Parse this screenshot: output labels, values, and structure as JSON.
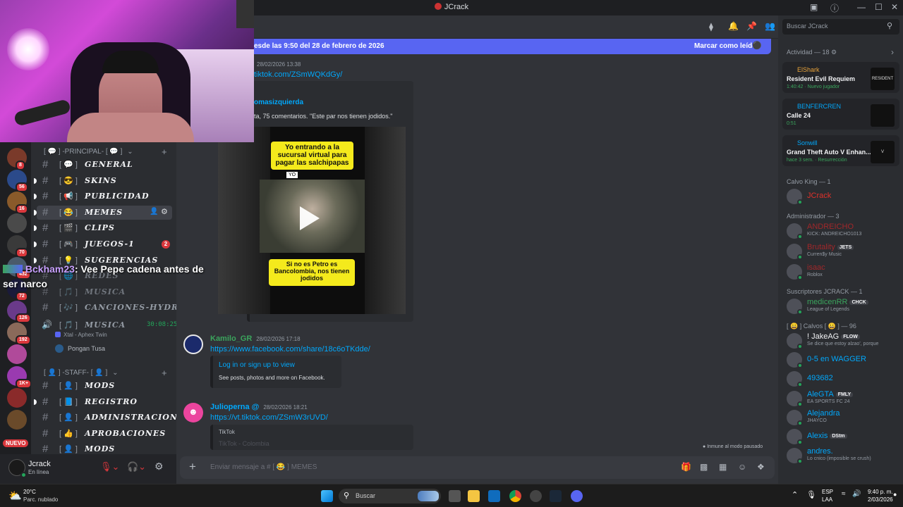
{
  "window": {
    "title": "JCrack",
    "controls": [
      "—",
      "☐",
      "✕"
    ]
  },
  "servers": [
    {
      "badge": "8",
      "color": "#7a3a2a"
    },
    {
      "badge": "56",
      "color": "#2b4a8a"
    },
    {
      "badge": "16",
      "color": "#8a5a2a"
    },
    {
      "badge": "",
      "color": "#4a4a4a"
    },
    {
      "badge": "70",
      "color": "#3a3a3a"
    },
    {
      "badge": "432",
      "color": "#4a5a6a"
    },
    {
      "badge": "72",
      "color": "#1a1a3a"
    },
    {
      "badge": "126",
      "color": "#6a3a8a"
    },
    {
      "badge": "192",
      "color": "#8a6a5a"
    },
    {
      "badge": "",
      "color": "#b04a9a"
    },
    {
      "badge": "1K+",
      "color": "#9a3ab0"
    },
    {
      "badge": "",
      "color": "#8a2a2a"
    },
    {
      "badge": "",
      "color": "#6a4a2a"
    }
  ],
  "server_new_label": "NUEVO",
  "channels": {
    "principal_category": "[ 💬 ] -PRINCIPAL- [ 💬 ]",
    "items": [
      {
        "emoji": "[ 💬 ]",
        "name": "GENERAL"
      },
      {
        "emoji": "[ 😎 ]",
        "name": "SKINS"
      },
      {
        "emoji": "[ 📢 ]",
        "name": "PUBLICIDAD"
      },
      {
        "emoji": "[ 😂 ]",
        "name": "MEMES"
      },
      {
        "emoji": "[ 🎬 ]",
        "name": "CLIPS"
      },
      {
        "emoji": "[ 🎮 ]",
        "name": "JUEGOS-1"
      },
      {
        "emoji": "[ 💡 ]",
        "name": "SUGERENCIAS"
      },
      {
        "emoji": "[ 🌐 ]",
        "name": "REDES"
      },
      {
        "emoji": "[ 🎵 ]",
        "name": "MUSICA"
      },
      {
        "emoji": "[ 🎶 ]",
        "name": "CANCIONES-HYDRA"
      }
    ],
    "juegos_badge": "2",
    "voice": {
      "emoji": "[ 🎵 ]",
      "name": "MUSICA",
      "timer": "30:08:25",
      "activity": "Xtal - Aphex Twin",
      "user": "Pongan Tusa"
    },
    "staff_category": "[ 👤 ] -STAFF- [ 👤 ]",
    "staff_items": [
      {
        "emoji": "[ 👤 ]",
        "name": "MODS"
      },
      {
        "emoji": "[ 📘 ]",
        "name": "REGISTRO"
      },
      {
        "emoji": "[ 👤 ]",
        "name": "ADMINISTRACION"
      },
      {
        "emoji": "[ 👍 ]",
        "name": "APROBACIONES"
      },
      {
        "emoji": "[ 👤 ]",
        "name": "MODS"
      }
    ]
  },
  "user": {
    "name": "Jcrack",
    "status": "En línea"
  },
  "chat_overlay": {
    "user": "Bckham23",
    "text": ": Vee Pepe cadena antes de ser narco"
  },
  "new_messages": {
    "text": "esde las 9:50 del 28 de febrero de 2026",
    "action": "Marcar como leído"
  },
  "messages": [
    {
      "timestamp": "28/02/2026 13:38",
      "link": "tiktok.com/ZSmWQKdGy/",
      "embed_author": "omasizquierda",
      "embed_desc": "ta, 75 comentarios. \"Este par nos tienen jodidos.\"",
      "meme_top": "Yo entrando a la sucursal virtual para pagar las salchipapas",
      "meme_yo": "YO",
      "meme_bottom": "Si no es Petro es Bancolombia, nos tienen jodidos"
    },
    {
      "user": "Kamilo_GR",
      "timestamp": "28/02/2026 17:18",
      "link": "https://www.facebook.com/share/18c6oTKdde/",
      "embed_title": "Log in or sign up to view",
      "embed_desc": "See posts, photos and more on Facebook."
    },
    {
      "user": "Julioperna @",
      "timestamp": "28/02/2026 18:21",
      "link": "https://vt.tiktok.com/ZSmW3rUVD/",
      "embed_provider": "TikTok",
      "embed_title": "TikTok - Colombia"
    }
  ],
  "immune_notice": "Inmune al modo pausado",
  "composer_placeholder": "Enviar mensaje a # [ 😂 ] MEMES",
  "search_placeholder": "Buscar JCrack",
  "members": {
    "activity_header": "Actividad — 18",
    "activities": [
      {
        "user": "ElShark",
        "game": "Resident Evil Requiem",
        "detail": "1:40:42 · Nuevo jugador",
        "art": "RESIDENT EVIL",
        "color": "#e8a33a"
      },
      {
        "user": "BENFERCREN",
        "game": "Calle 24",
        "detail": "0:51",
        "art": "",
        "color": "#00a8fc"
      },
      {
        "user": "Sonwill",
        "game": "Grand Theft Auto V Enhan...",
        "detail": "hace 3 sem. · Resurrección",
        "art": "V",
        "color": "#00a8fc"
      }
    ],
    "groups": [
      {
        "title": "Calvo King — 1",
        "members": [
          {
            "name": "JCrack",
            "sub": "",
            "tag": "",
            "color": "#e0312a"
          }
        ]
      },
      {
        "title": "Administrador — 3",
        "members": [
          {
            "name": "ANDREICHO",
            "sub": "KICK: ANDREICHO1013",
            "tag": "",
            "color": "#a1272a"
          },
          {
            "name": "Brutality",
            "sub": "Curren$y Music",
            "tag": "JETS",
            "color": "#a1272a"
          },
          {
            "name": "isaac",
            "sub": "Roblox",
            "tag": "",
            "color": "#a1272a"
          }
        ]
      },
      {
        "title": "Suscriptores JCRACK — 1",
        "members": [
          {
            "name": "medicenRR",
            "sub": "League of Legends",
            "tag": "CHCK",
            "color": "#3ba55d"
          }
        ]
      },
      {
        "title": "[ 😀 ] Calvos [ 😀 ] — 96",
        "members": [
          {
            "name": "! JakeAG",
            "sub": "Se dice que estoy alzao', porque",
            "tag": "FLOW",
            "color": "#f2f3f5"
          },
          {
            "name": "0-5 en WAGGER",
            "sub": "",
            "tag": "",
            "color": "#00a8fc"
          },
          {
            "name": "493682",
            "sub": "",
            "tag": "",
            "color": "#00a8fc"
          },
          {
            "name": "AleGTA",
            "sub": "EA SPORTS FC 24",
            "tag": "FMLY",
            "color": "#00a8fc"
          },
          {
            "name": "Alejandra",
            "sub": "JHAYCO",
            "tag": "",
            "color": "#00a8fc"
          },
          {
            "name": "Alexis",
            "sub": "",
            "tag": "DStm",
            "color": "#00a8fc"
          },
          {
            "name": "andres.",
            "sub": "Lo cnico (imposible se crush)",
            "tag": "",
            "color": "#00a8fc"
          }
        ]
      }
    ]
  },
  "taskbar": {
    "weather_temp": "20°C",
    "weather_desc": "Parc. nublado",
    "search": "Buscar",
    "lang1": "ESP",
    "lang2": "LAA",
    "time": "9:40 p. m.",
    "date": "2/03/2026"
  }
}
